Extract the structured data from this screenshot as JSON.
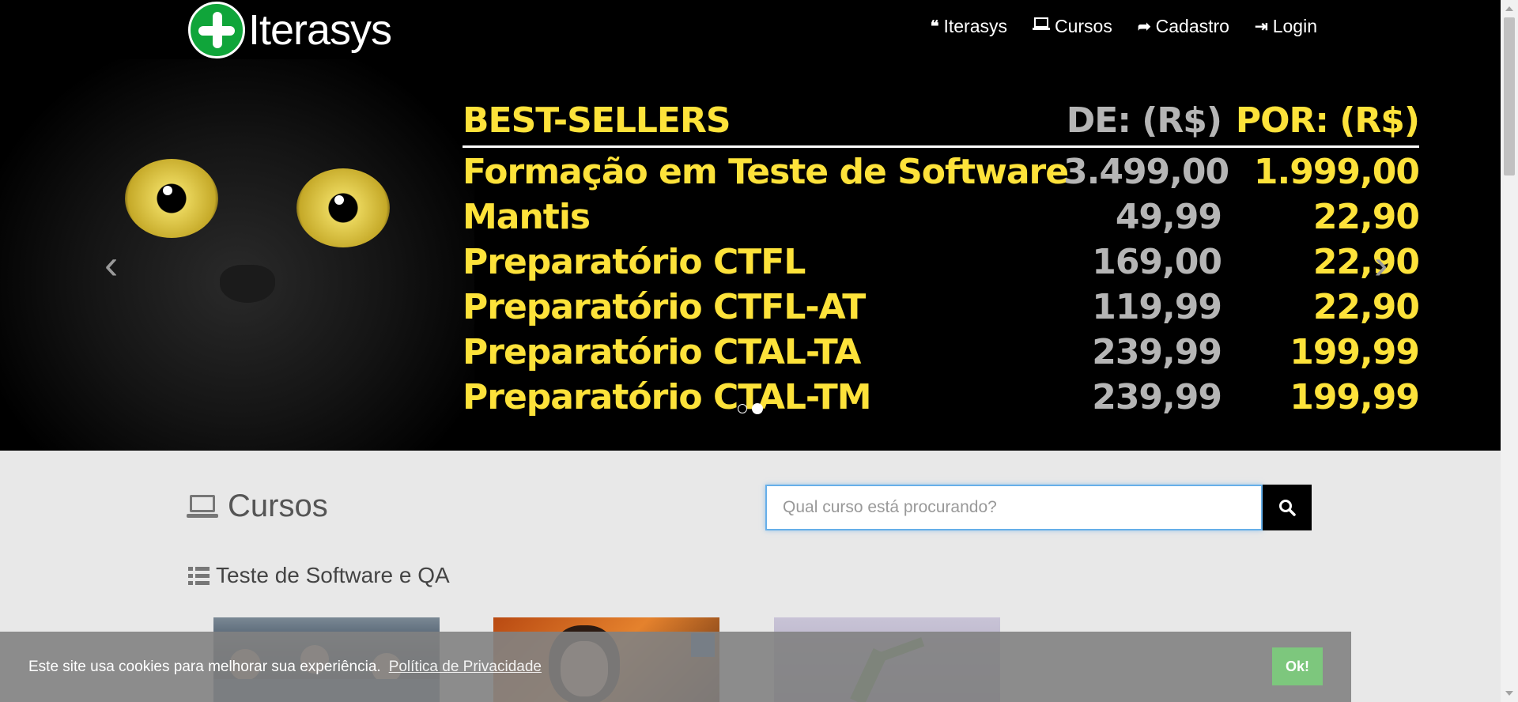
{
  "brand": {
    "name": "Iterasys"
  },
  "nav": {
    "items": [
      {
        "label": "Iterasys",
        "icon": "quote-icon",
        "glyph": "❝"
      },
      {
        "label": "Cursos",
        "icon": "laptop-icon",
        "glyph": "💻"
      },
      {
        "label": "Cadastro",
        "icon": "share-icon",
        "glyph": "➦"
      },
      {
        "label": "Login",
        "icon": "sign-in-icon",
        "glyph": "⇥"
      }
    ]
  },
  "carousel": {
    "table": {
      "headers": {
        "title": "BEST-SELLERS",
        "from": "DE: (R$)",
        "to": "POR: (R$)"
      },
      "rows": [
        {
          "name": "Formação em Teste de Software",
          "from": "3.499,00",
          "to": "1.999,00"
        },
        {
          "name": "Mantis",
          "from": "49,99",
          "to": "22,90"
        },
        {
          "name": "Preparatório CTFL",
          "from": "169,00",
          "to": "22,90"
        },
        {
          "name": "Preparatório CTFL-AT",
          "from": "119,99",
          "to": "22,90"
        },
        {
          "name": "Preparatório CTAL-TA",
          "from": "239,99",
          "to": "199,99"
        },
        {
          "name": "Preparatório CTAL-TM",
          "from": "239,99",
          "to": "199,99"
        }
      ]
    },
    "prev_glyph": "‹",
    "next_glyph": "›",
    "indicators": 2,
    "active_indicator": 1
  },
  "courses": {
    "title": "Cursos",
    "search_placeholder": "Qual curso está procurando?",
    "category": "Teste de Software e QA"
  },
  "cookie": {
    "text": "Este site usa cookies para melhorar sua experiência.",
    "link": "Política de Privacidade",
    "button": "Ok!"
  },
  "colors": {
    "accent_yellow": "#fde23a",
    "price_gray": "#b5b5b5",
    "logo_green": "#10a53a",
    "ok_button": "#7dc77d"
  }
}
